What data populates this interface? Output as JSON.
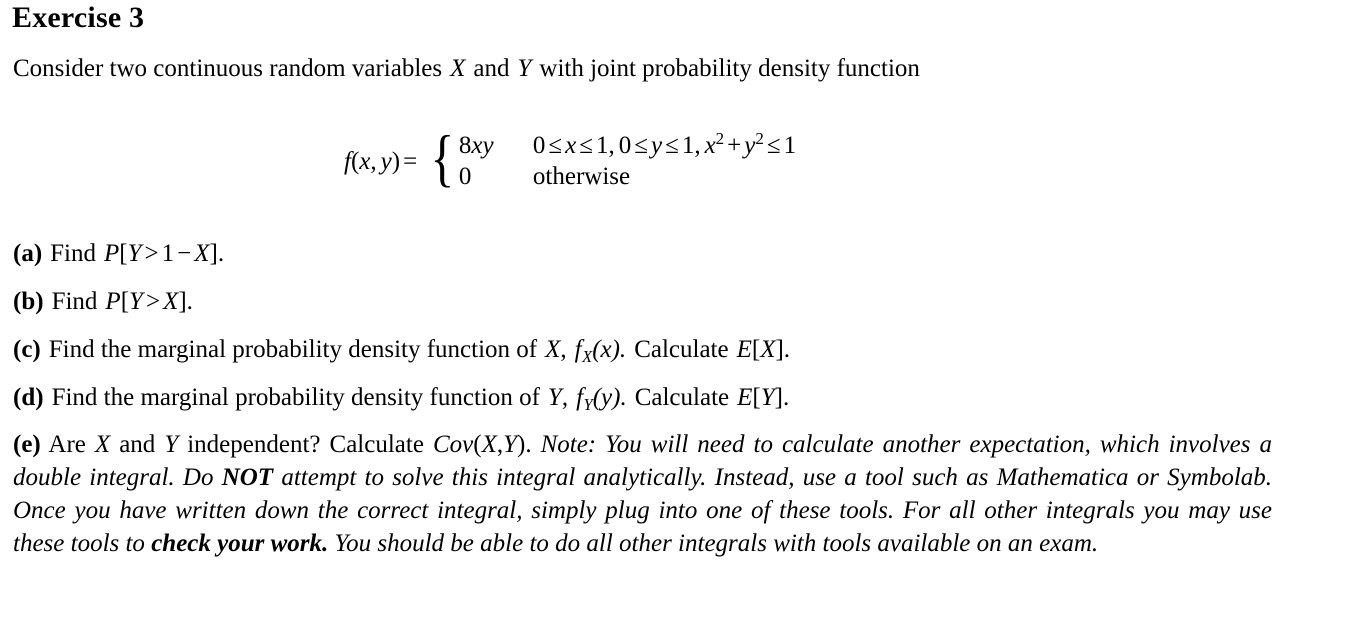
{
  "document": {
    "heading": "Exercise 3",
    "intro": {
      "part1": "Consider two continuous random variables",
      "var_x": "X",
      "and": "and",
      "var_y": "Y",
      "part2": "with joint probability density function"
    },
    "equation": {
      "lhs": "f(x, y) =",
      "lhs_f": "f",
      "lhs_open": "(",
      "lhs_x": "x",
      "lhs_comma": ",",
      "lhs_y": "y",
      "lhs_close": ")",
      "lhs_eq": "=",
      "brace": "{",
      "case1_value": "8xy",
      "case1_value_8": "8",
      "case1_value_x": "x",
      "case1_value_y": "y",
      "case1_condition": "0 ≤ x ≤ 1, 0 ≤ y ≤ 1, x² + y² ≤ 1",
      "cond_zero_a": "0",
      "cond_le1": "≤",
      "cond_x": "x",
      "cond_le2": "≤",
      "cond_one_a": "1,",
      "cond_zero_b": "0",
      "cond_le3": "≤",
      "cond_y": "y",
      "cond_le4": "≤",
      "cond_one_b": "1,",
      "cond_x2_base": "x",
      "cond_x2_exp": "2",
      "cond_plus": "+",
      "cond_y2_base": "y",
      "cond_y2_exp": "2",
      "cond_le5": "≤",
      "cond_one_c": "1",
      "case2_value": "0",
      "case2_condition": "otherwise"
    },
    "items": [
      {
        "tag": "(a)",
        "text_find": "Find",
        "math": "P[Y > 1 − X].",
        "m_P": "P",
        "m_open": "[",
        "m_Y": "Y",
        "m_gt": ">",
        "m_one": "1",
        "m_minus": "−",
        "m_X": "X",
        "m_close": "].",
        "full": "(a) Find P[Y > 1 − X]."
      },
      {
        "tag": "(b)",
        "text_find": "Find",
        "math": "P[Y > X].",
        "m_P": "P",
        "m_open": "[",
        "m_Y": "Y",
        "m_gt": ">",
        "m_X": "X",
        "m_close": "].",
        "full": "(b) Find P[Y > X]."
      },
      {
        "tag": "(c)",
        "lead": "Find the marginal probability density function of",
        "var": "X",
        "comma": ",",
        "fn_base": "f",
        "fn_sub": "X",
        "fn_arg": "(x).",
        "calc": "Calculate",
        "exp_E": "E",
        "exp_open": "[",
        "exp_var": "X",
        "exp_close": "].",
        "full": "(c) Find the marginal probability density function of X, fX(x). Calculate E[X]."
      },
      {
        "tag": "(d)",
        "lead": "Find the marginal probability density function of",
        "var": "Y",
        "comma": ",",
        "fn_base": "f",
        "fn_sub": "Y",
        "fn_arg": "(y).",
        "calc": "Calculate",
        "exp_E": "E",
        "exp_open": "[",
        "exp_var": "Y",
        "exp_close": "].",
        "full": "(d) Find the marginal probability density function of Y, fY(y). Calculate E[Y]."
      }
    ],
    "item_e": {
      "tag": "(e)",
      "q_are": "Are",
      "q_x": "X",
      "q_and": "and",
      "q_y": "Y",
      "q_independent": "independent?",
      "q_calculate": "Calculate",
      "q_cov_name": "Cov",
      "q_cov_open": "(",
      "q_cov_x": "X",
      "q_cov_comma": ",",
      "q_cov_y": "Y",
      "q_cov_close": ").",
      "note_1": "Note: You will need to calculate another expectation, which involves a double integral. Do",
      "note_bold_1": "NOT",
      "note_2": "attempt to solve this integral analytically. Instead, use a tool such as Mathematica or Symbolab. Once you have written down the correct integral, simply plug into one of these tools. For all other integrals you may use these tools to",
      "note_bold_2": "check your work.",
      "note_3": "You should be able to do all other integrals with tools available on an exam.",
      "full": "(e) Are X and Y independent? Calculate Cov(X,Y). Note: You will need to calculate another expectation, which involves a double integral. Do NOT attempt to solve this integral analytically. Instead, use a tool such as Mathematica or Symbolab. Once you have written down the correct integral, simply plug into one of these tools. For all other integrals you may use these tools to check your work. You should be able to do all other integrals with tools available on an exam."
    }
  }
}
